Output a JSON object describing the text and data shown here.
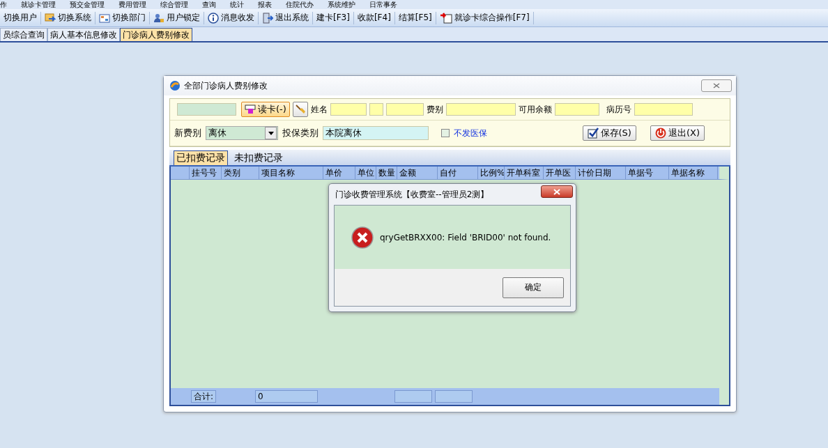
{
  "menu": [
    "作",
    "就诊卡管理",
    "预交金管理",
    "费用管理",
    "综合管理",
    "查询",
    "统计",
    "报表",
    "住院代办",
    "系统维护",
    "日常事务"
  ],
  "toolbar": [
    {
      "label": "切换用户",
      "kind": "text"
    },
    {
      "label": "切换系统",
      "kind": "switch"
    },
    {
      "label": "切换部门",
      "kind": "dept"
    },
    {
      "label": "用户锁定",
      "kind": "lock"
    },
    {
      "label": "消息收发",
      "kind": "info"
    },
    {
      "label": "退出系统",
      "kind": "exit"
    },
    {
      "label": "建卡[F3]",
      "kind": "text"
    },
    {
      "label": "收款[F4]",
      "kind": "text"
    },
    {
      "label": "结算[F5]",
      "kind": "text"
    },
    {
      "label": "就诊卡综合操作[F7]",
      "kind": "card"
    }
  ],
  "tabs": [
    {
      "label": "员综合查询",
      "selected": false
    },
    {
      "label": "病人基本信息修改",
      "selected": false
    },
    {
      "label": "门诊病人费别修改",
      "selected": true
    }
  ],
  "window": {
    "title": "全部门诊病人费别修改",
    "read_card": "读卡(-)",
    "name_label": "姓名",
    "fee_label": "费别",
    "balance_label": "可用余额",
    "record_label": "病历号",
    "new_fee_label": "新费别",
    "new_fee": "离休",
    "insure_label": "投保类别",
    "insure": "本院离休",
    "no_insurance": {
      "label": "不发医保",
      "checked": false
    },
    "save": "保存(S)",
    "exit": "退出(X)",
    "subtabs": [
      {
        "label": "已扣费记录",
        "selected": true
      },
      {
        "label": "未扣费记录",
        "selected": false
      }
    ],
    "columns": [
      "挂号号",
      "类别",
      "项目名称",
      "单价",
      "单位",
      "数量",
      "金额",
      "自付",
      "比例%",
      "开单科室",
      "开单医",
      "计价日期",
      "单据号",
      "单据名称"
    ],
    "total_label": "合计:",
    "total": "0"
  },
  "dialog": {
    "title": "门诊收费管理系统【收费室--管理员2测】",
    "message": "qryGetBRXX00: Field 'BRID00' not found.",
    "ok": "确定"
  }
}
